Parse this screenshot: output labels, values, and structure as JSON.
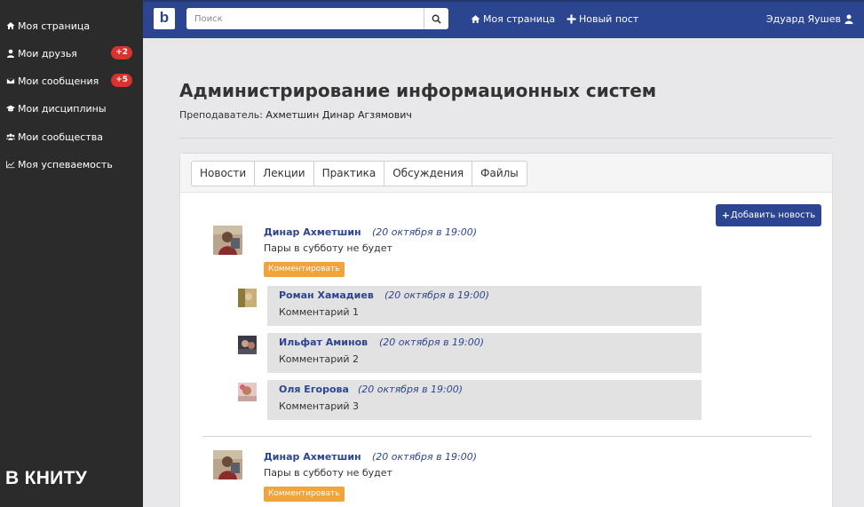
{
  "sidebar": {
    "items": [
      {
        "label": "Моя страница",
        "icon": "home-icon"
      },
      {
        "label": "Мои друзья",
        "icon": "user-icon",
        "badge": "+2"
      },
      {
        "label": "Мои сообщения",
        "icon": "envelope-icon",
        "badge": "+5"
      },
      {
        "label": "Мои дисциплины",
        "icon": "graduation-cap-icon"
      },
      {
        "label": "Мои сообщества",
        "icon": "users-icon"
      },
      {
        "label": "Моя успеваемость",
        "icon": "line-chart-icon"
      }
    ],
    "brand": "В КНИТУ"
  },
  "topbar": {
    "logo": "b",
    "search_placeholder": "Поиск",
    "nav": [
      {
        "label": "Моя страница",
        "icon": "home-icon"
      },
      {
        "label": "Новый пост",
        "icon": "plus-icon"
      }
    ],
    "user_name": "Эдуард Яушев"
  },
  "course": {
    "title": "Администрирование информационных систем",
    "teacher_label": "Преподаватель:",
    "teacher_name": "Ахметшин Динар Агзямович"
  },
  "tabs": [
    "Новости",
    "Лекции",
    "Практика",
    "Обсуждения",
    "Файлы"
  ],
  "add_news_label": "Добавить новость",
  "posts": [
    {
      "author": "Динар Ахметшин",
      "date": "(20 октября в 19:00)",
      "text": "Пары в субботу не будет",
      "comment_label": "Комментировать",
      "comments": [
        {
          "author": "Роман Хамадиев",
          "date": "(20 октября в 19:00)",
          "text": "Комментарий 1"
        },
        {
          "author": "Ильфат Аминов",
          "date": "(20 октября в 19:00)",
          "text": "Комментарий 2"
        },
        {
          "author": "Оля Егорова",
          "date": "(20 октября в 19:00)",
          "text": "Комментарий 3"
        }
      ]
    },
    {
      "author": "Динар Ахметшин",
      "date": "(20 октября в 19:00)",
      "text": "Пары в субботу не будет",
      "comment_label": "Комментировать"
    }
  ],
  "colors": {
    "sidebar_bg": "#2b2b2b",
    "topbar_bg": "#2c4590",
    "badge": "#d9332e",
    "comment_button": "#f0a43b",
    "link": "#2c4590"
  }
}
